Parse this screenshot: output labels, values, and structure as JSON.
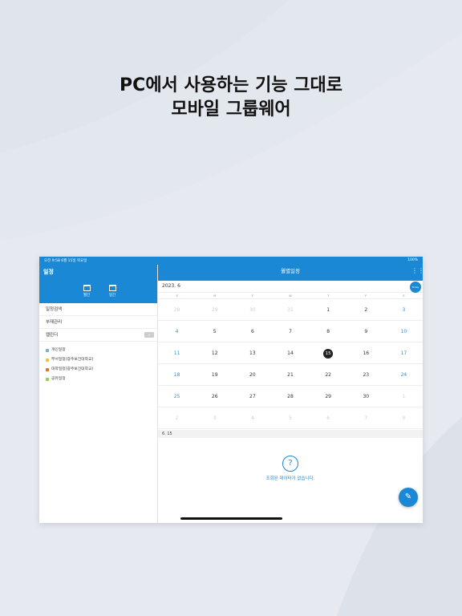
{
  "headline": {
    "line1": "PC에서 사용하는 기능 그대로",
    "line2": "모바일 그룹웨어"
  },
  "status": {
    "left": "오전 9:58   6월 15일 목요일",
    "right": "100%"
  },
  "sidebar": {
    "title": "일정",
    "icons": [
      {
        "label": "월간",
        "icon": "calendar-icon"
      },
      {
        "label": "일간",
        "icon": "calendar-day-icon"
      }
    ],
    "menu": [
      {
        "label": "일정검색"
      },
      {
        "label": "부재관리"
      },
      {
        "label": "캘린더",
        "tag": "+"
      }
    ],
    "calendars": [
      {
        "label": "개인일정",
        "color": "#7fb0e0"
      },
      {
        "label": "부서일정(광주보건대학교)",
        "color": "#f2c04a"
      },
      {
        "label": "대학일정(광주보건대학교)",
        "color": "#e0753a"
      },
      {
        "label": "공유일정",
        "color": "#9ccf5a"
      }
    ]
  },
  "main": {
    "title": "월별일정",
    "month": "2023. 6",
    "today_btn": "Today",
    "weekdays": [
      "S",
      "M",
      "T",
      "W",
      "T",
      "F",
      "S"
    ],
    "weeks": [
      [
        "28",
        "29",
        "30",
        "31",
        "1",
        "2",
        "3"
      ],
      [
        "4",
        "5",
        "6",
        "7",
        "8",
        "9",
        "10"
      ],
      [
        "11",
        "12",
        "13",
        "14",
        "15",
        "16",
        "17"
      ],
      [
        "18",
        "19",
        "20",
        "21",
        "22",
        "23",
        "24"
      ],
      [
        "25",
        "26",
        "27",
        "28",
        "29",
        "30",
        "1"
      ],
      [
        "2",
        "3",
        "4",
        "5",
        "6",
        "7",
        "8"
      ]
    ],
    "selected_date": "6. 15",
    "empty_text": "조회된 데이터가 없습니다."
  }
}
